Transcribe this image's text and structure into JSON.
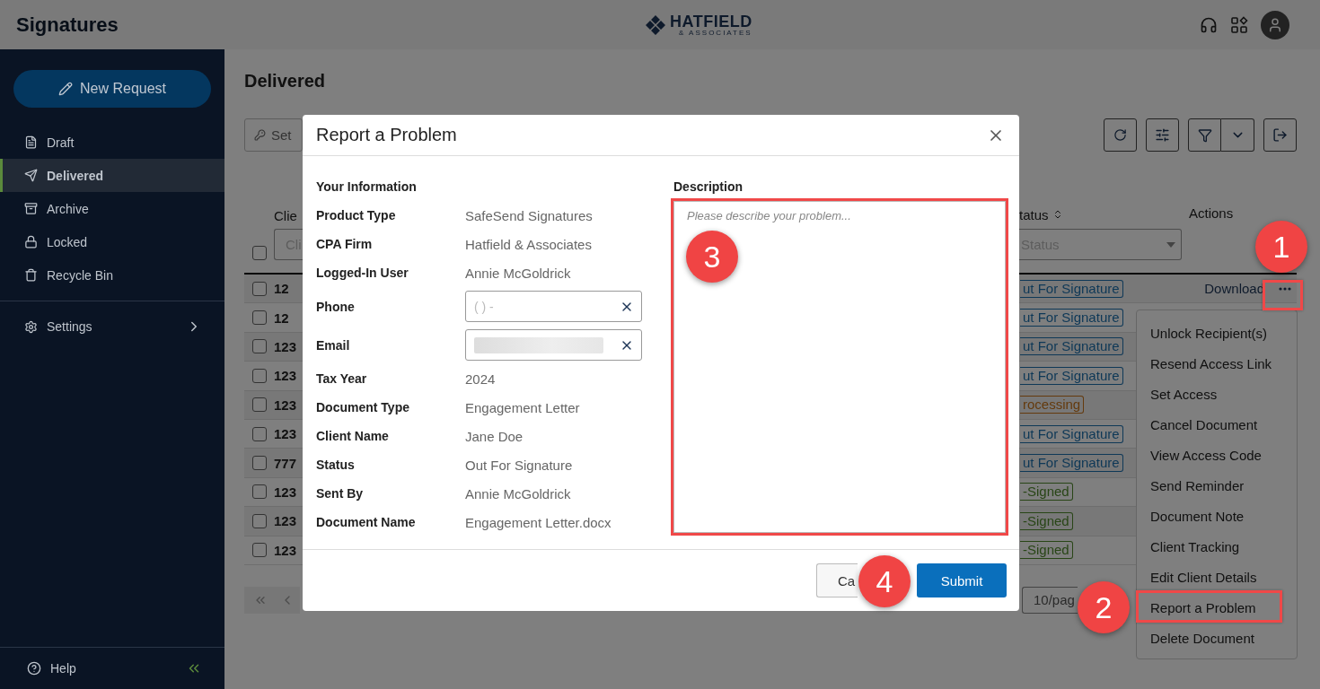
{
  "app": {
    "title": "Signatures",
    "logo": {
      "name": "HATFIELD",
      "tagline": "& ASSOCIATES"
    }
  },
  "sidebar": {
    "new_request": "New Request",
    "items": [
      {
        "label": "Draft",
        "selected": false
      },
      {
        "label": "Delivered",
        "selected": true
      },
      {
        "label": "Archive",
        "selected": false
      },
      {
        "label": "Locked",
        "selected": false
      },
      {
        "label": "Recycle Bin",
        "selected": false
      }
    ],
    "settings": "Settings",
    "help": "Help"
  },
  "page": {
    "title": "Delivered",
    "set_access": "Set"
  },
  "table": {
    "columns": [
      {
        "label": "Clie"
      },
      {
        "label": "tatus"
      },
      {
        "label": "Actions"
      }
    ],
    "filters": {
      "client": "Cli",
      "status": "Status"
    },
    "select_all_checked": false,
    "rows": [
      {
        "id": "12",
        "checked": false,
        "status": {
          "text": "ut For Signature",
          "color": "#0e3857"
        },
        "action": "Download"
      },
      {
        "id": "12",
        "checked": false,
        "status": {
          "text": "ut For Signature",
          "color": "#0e3857"
        }
      },
      {
        "id": "123",
        "checked": false,
        "status": {
          "text": "ut For Signature",
          "color": "#0e3857"
        }
      },
      {
        "id": "123",
        "checked": false,
        "status": {
          "text": "ut For Signature",
          "color": "#0e3857"
        }
      },
      {
        "id": "123",
        "checked": false,
        "status": {
          "text": "rocessing",
          "color": "#643a0d"
        }
      },
      {
        "id": "123",
        "checked": false,
        "status": {
          "text": "ut For Signature",
          "color": "#0e3857"
        }
      },
      {
        "id": "777",
        "checked": false,
        "status": {
          "text": "ut For Signature",
          "color": "#0e3857"
        }
      },
      {
        "id": "123",
        "checked": false,
        "status": {
          "text": "-Signed",
          "color": "#284516"
        }
      },
      {
        "id": "123",
        "checked": false,
        "status": {
          "text": "-Signed",
          "color": "#284516"
        }
      },
      {
        "id": "123",
        "checked": false,
        "status": {
          "text": "-Signed",
          "color": "#284516"
        }
      }
    ]
  },
  "pagination": {
    "page_size": "10/pag"
  },
  "menu": {
    "items": [
      "Unlock Recipient(s)",
      "Resend Access Link",
      "Set Access",
      "Cancel Document",
      "View Access Code",
      "Send Reminder",
      "Document Note",
      "Client Tracking",
      "Edit Client Details",
      "Report a Problem",
      "Delete Document"
    ]
  },
  "dialog": {
    "title": "Report a Problem",
    "section": "Your Information",
    "fields": [
      {
        "label": "Product Type",
        "kind": "text",
        "value": "SafeSend Signatures"
      },
      {
        "label": "CPA Firm",
        "kind": "text",
        "value": "Hatfield & Associates"
      },
      {
        "label": "Logged-In User",
        "kind": "text",
        "value": "Annie McGoldrick"
      },
      {
        "label": "Phone",
        "kind": "input",
        "placeholder": "( ) -"
      },
      {
        "label": "Email",
        "kind": "redacted"
      },
      {
        "label": "Tax Year",
        "kind": "text",
        "value": "2024"
      },
      {
        "label": "Document Type",
        "kind": "text",
        "value": "Engagement Letter"
      },
      {
        "label": "Client Name",
        "kind": "text",
        "value": "Jane Doe"
      },
      {
        "label": "Status",
        "kind": "text",
        "value": "Out For Signature"
      },
      {
        "label": "Sent By",
        "kind": "text",
        "value": "Annie McGoldrick"
      },
      {
        "label": "Document Name",
        "kind": "text",
        "value": "Engagement Letter.docx"
      }
    ],
    "description": {
      "label": "Description",
      "placeholder": "Please describe your problem..."
    },
    "buttons": {
      "cancel": "Ca",
      "submit": "Submit"
    }
  },
  "annotations": [
    {
      "number": "1"
    },
    {
      "number": "2"
    },
    {
      "number": "3"
    },
    {
      "number": "4"
    }
  ]
}
